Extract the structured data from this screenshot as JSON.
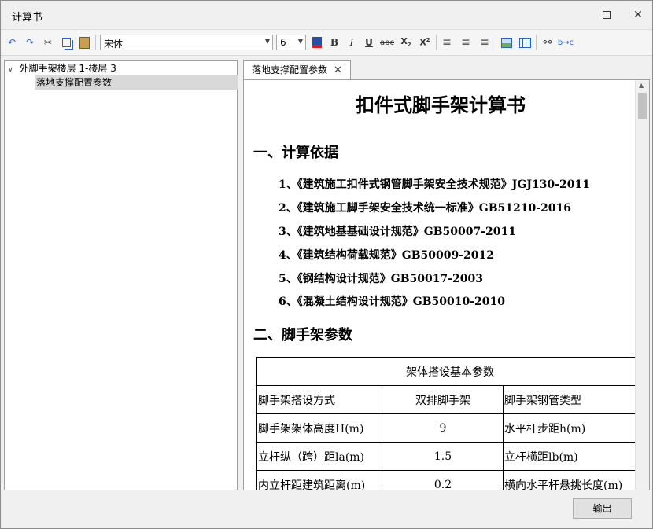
{
  "window": {
    "title": "计算书"
  },
  "toolbar": {
    "font_name": "宋体",
    "font_size": "6"
  },
  "tree": {
    "root": "外脚手架楼层 1-楼层 3",
    "child": "落地支撑配置参数"
  },
  "tab": {
    "label": "落地支撑配置参数"
  },
  "doc": {
    "title": "扣件式脚手架计算书",
    "section1": "一、计算依据",
    "refs": [
      "1、《建筑施工扣件式钢管脚手架安全技术规范》JGJ130-2011",
      "2、《建筑施工脚手架安全技术统一标准》GB51210-2016",
      "3、《建筑地基基础设计规范》GB50007-2011",
      "4、《建筑结构荷载规范》GB50009-2012",
      "5、《钢结构设计规范》GB50017-2003",
      "6、《混凝土结构设计规范》GB50010-2010"
    ],
    "section2": "二、脚手架参数",
    "table": {
      "header": "架体搭设基本参数",
      "rows": [
        {
          "k1": "脚手架搭设方式",
          "v1": "双排脚手架",
          "k2": "脚手架钢管类型"
        },
        {
          "k1": "脚手架架体高度H(m)",
          "v1": "9",
          "k2": "水平杆步距h(m)"
        },
        {
          "k1": "立杆纵（跨）距la(m)",
          "v1": "1.5",
          "k2": "立杆横距lb(m)"
        },
        {
          "k1": "内立杆距建筑距离(m)",
          "v1": "0.2",
          "k2": "横向水平杆悬挑长度(m)"
        }
      ]
    }
  },
  "footer": {
    "output_label": "输出"
  }
}
